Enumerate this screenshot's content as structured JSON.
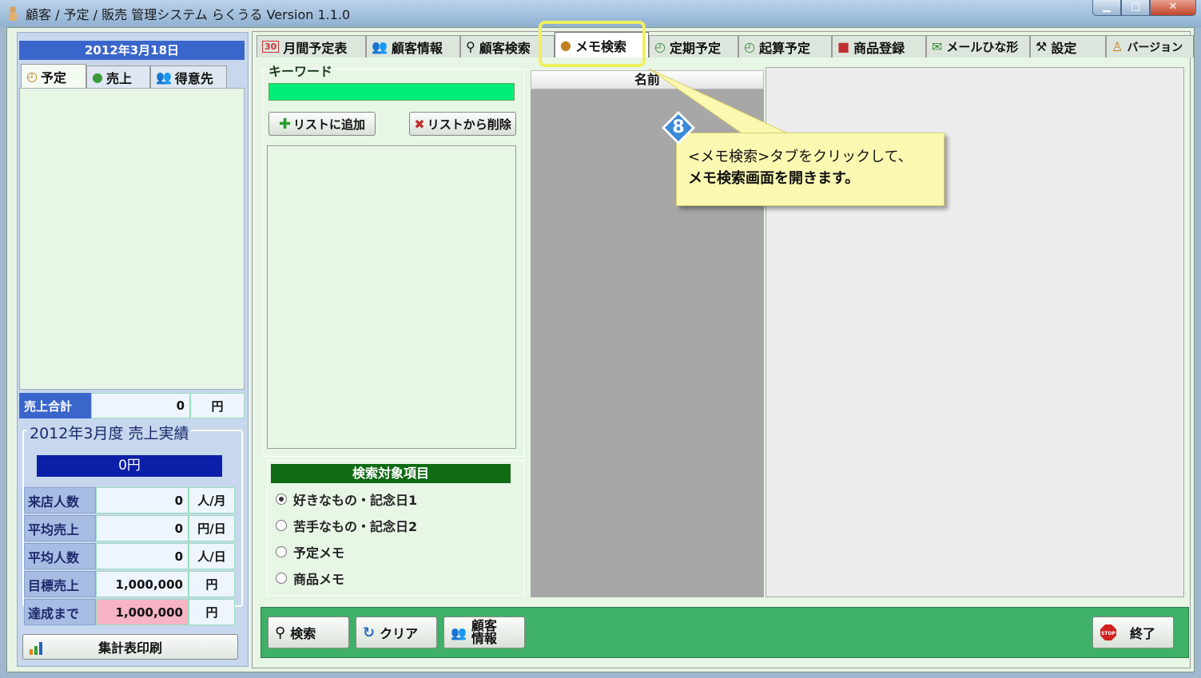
{
  "window": {
    "title": "顧客 / 予定 / 販売 管理システム らくうる  Version 1.1.0"
  },
  "left": {
    "date": "2012年3月18日",
    "tabs": [
      "予定",
      "売上",
      "得意先"
    ],
    "sales_total": {
      "label": "売上合計",
      "value": "0",
      "unit": "円"
    },
    "results": {
      "title": "2012年3月度 売上実績",
      "total": "0円",
      "rows": [
        {
          "label": "来店人数",
          "value": "0",
          "unit": "人/月"
        },
        {
          "label": "平均売上",
          "value": "0",
          "unit": "円/日"
        },
        {
          "label": "平均人数",
          "value": "0",
          "unit": "人/日"
        },
        {
          "label": "目標売上",
          "value": "1,000,000",
          "unit": "円"
        },
        {
          "label": "達成まで",
          "value": "1,000,000",
          "unit": "円"
        }
      ]
    },
    "print_button": "集計表印刷"
  },
  "tabs": [
    "月間予定表",
    "顧客情報",
    "顧客検索",
    "メモ検索",
    "定期予定",
    "起算予定",
    "商品登録",
    "メールひな形",
    "設定",
    "バージョン"
  ],
  "memo_search": {
    "keyword_label": "キーワード",
    "keyword_value": "",
    "add_button": "リストに追加",
    "remove_button": "リストから削除",
    "target_header": "検索対象項目",
    "targets": [
      "好きなもの・記念日1",
      "苦手なもの・記念日2",
      "予定メモ",
      "商品メモ"
    ],
    "selected_target": 0,
    "name_column": "名前"
  },
  "bottom": {
    "search": "検索",
    "clear": "クリア",
    "customer_info_l1": "顧客",
    "customer_info_l2": "情報",
    "exit": "終了"
  },
  "callout": {
    "step": "8",
    "line1": "<メモ検索>タブをクリックして、",
    "line2": "メモ検索画面を開きます。"
  },
  "colors": {
    "accent_blue": "#3a66cc",
    "navy": "#0b1fa8",
    "green_bar": "#3fb067",
    "keyword_green": "#00ee77",
    "callout_bg": "#fbf8b2"
  }
}
